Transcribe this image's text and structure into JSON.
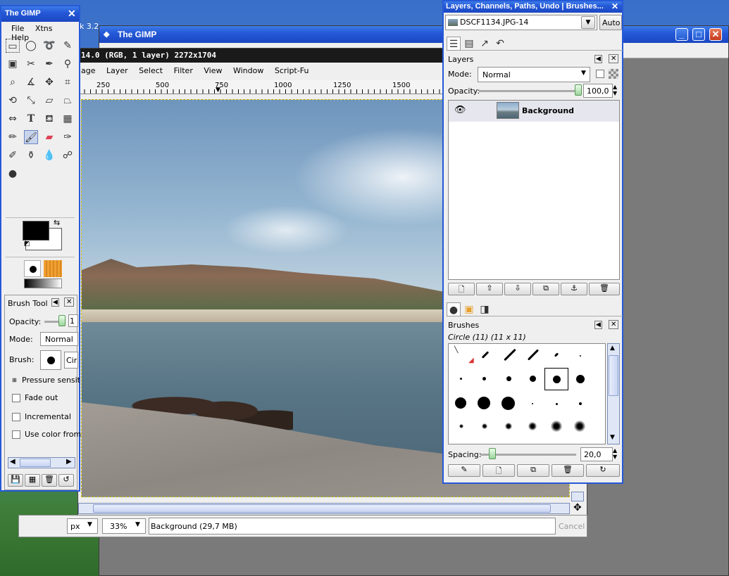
{
  "toolbox": {
    "title": "The GIMP",
    "menu": [
      "File",
      "Xtns",
      "Help"
    ],
    "tool_options_title": "Brush Tool",
    "opacity_label": "Opacity:",
    "opacity_value": "1",
    "mode_label": "Mode:",
    "mode_value": "Normal",
    "brush_label": "Brush:",
    "brush_value": "Cir",
    "pressure_label": "Pressure sensit",
    "fade_out_label": "Fade out",
    "incremental_label": "Incremental",
    "use_color_label": "Use color from"
  },
  "background_window": {
    "title": "The GIMP",
    "behind_text": "k 3.2"
  },
  "image_window": {
    "info": "14.0 (RGB, 1 layer) 2272x1704",
    "menu": [
      "age",
      "Layer",
      "Select",
      "Filter",
      "View",
      "Window",
      "Script-Fu"
    ],
    "ruler": [
      "250",
      "500",
      "750",
      "1000",
      "1250",
      "1500"
    ],
    "unit": "px",
    "zoom": "33%",
    "status": "Background (29,7 MB)",
    "cancel_label": "Cancel"
  },
  "dock": {
    "title": "Layers, Channels, Paths, Undo | Brushes...",
    "image_select": "DSCF1134.JPG-14",
    "auto_label": "Auto",
    "layers": {
      "title": "Layers",
      "mode_label": "Mode:",
      "mode_value": "Normal",
      "opacity_label": "Opacity:",
      "opacity_value": "100,0",
      "items": [
        {
          "name": "Background"
        }
      ]
    },
    "brushes": {
      "title": "Brushes",
      "selected": "Circle (11) (11 x 11)",
      "spacing_label": "Spacing:",
      "spacing_value": "20,0"
    }
  },
  "colors": {
    "titlebar": "#2559d8",
    "close": "#c3391b",
    "panel": "#efefef"
  }
}
